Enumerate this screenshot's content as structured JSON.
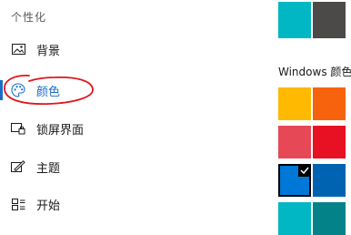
{
  "sidebar": {
    "section_title": "个性化",
    "items": [
      {
        "label": "背景",
        "icon": "picture-icon"
      },
      {
        "label": "颜色",
        "icon": "palette-icon",
        "active": true
      },
      {
        "label": "锁屏界面",
        "icon": "lock-screen-icon"
      },
      {
        "label": "主题",
        "icon": "theme-icon"
      },
      {
        "label": "开始",
        "icon": "start-icon"
      }
    ]
  },
  "content": {
    "color_heading": "Windows 颜色",
    "top_swatches": [
      "#00b7c3",
      "#4c4a48"
    ],
    "swatch_rows": [
      [
        "#ffb900",
        "#f7630c"
      ],
      [
        "#e74856",
        "#e81123"
      ],
      [
        "#0078d7",
        "#0063b1"
      ],
      [
        "#00b7c3",
        "#038387"
      ]
    ],
    "selected_swatch": "#0078d7"
  },
  "colors": {
    "accent": "#1a6ec7",
    "annotation": "#e0161a"
  }
}
